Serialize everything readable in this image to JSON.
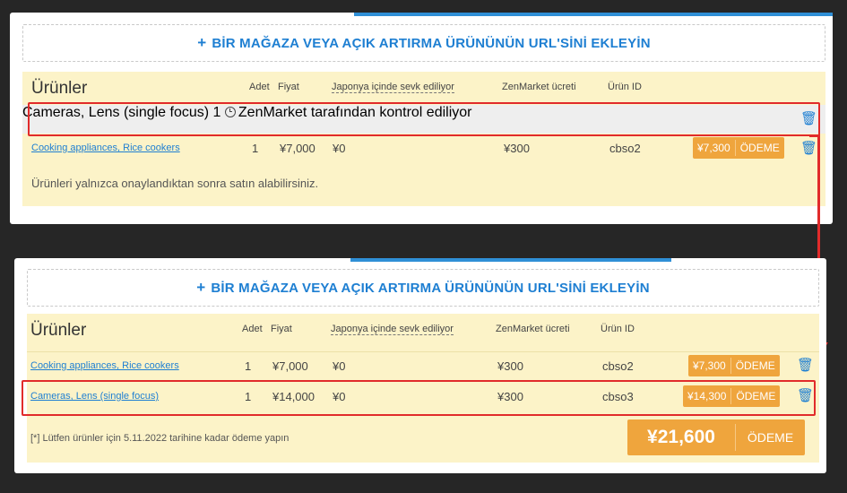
{
  "add_link": {
    "plus": "+",
    "label": "BİR MAĞAZA VEYA AÇIK ARTIRMA ÜRÜNÜNÜN URL'SİNİ EKLEYİN"
  },
  "headers": {
    "title": "Ürünler",
    "qty": "Adet",
    "price": "Fiyat",
    "domestic": "Japonya içinde sevk ediliyor",
    "fee": "ZenMarket ücreti",
    "id": "Ürün ID"
  },
  "top": {
    "rows": [
      {
        "name": "Cameras, Lens (single focus)",
        "qty": "1",
        "status": "ZenMarket tarafından kontrol ediliyor"
      },
      {
        "name": "Cooking appliances, Rice cookers",
        "qty": "1",
        "price": "¥7,000",
        "domestic": "¥0",
        "fee": "¥300",
        "id": "cbso2",
        "total": "¥7,300",
        "pay": "ÖDEME"
      }
    ],
    "notice": "Ürünleri yalnızca onaylandıktan sonra satın alabilirsiniz."
  },
  "bottom": {
    "rows": [
      {
        "name": "Cooking appliances, Rice cookers",
        "qty": "1",
        "price": "¥7,000",
        "domestic": "¥0",
        "fee": "¥300",
        "id": "cbso2",
        "total": "¥7,300",
        "pay": "ÖDEME"
      },
      {
        "name": "Cameras, Lens (single focus)",
        "qty": "1",
        "price": "¥14,000",
        "domestic": "¥0",
        "fee": "¥300",
        "id": "cbso3",
        "total": "¥14,300",
        "pay": "ÖDEME"
      }
    ],
    "deadline": "[*] Lütfen ürünler için 5.11.2022 tarihine kadar ödeme yapın",
    "grand_total": "¥21,600",
    "grand_pay": "ÖDEME"
  },
  "colors": {
    "accent": "#1e7fd2",
    "orange": "#efa53d",
    "highlight": "#e12b2b",
    "table_bg": "#fcf3c8"
  },
  "icons": {
    "trash": "trash-icon",
    "clock": "clock-icon",
    "plus": "plus-icon"
  }
}
